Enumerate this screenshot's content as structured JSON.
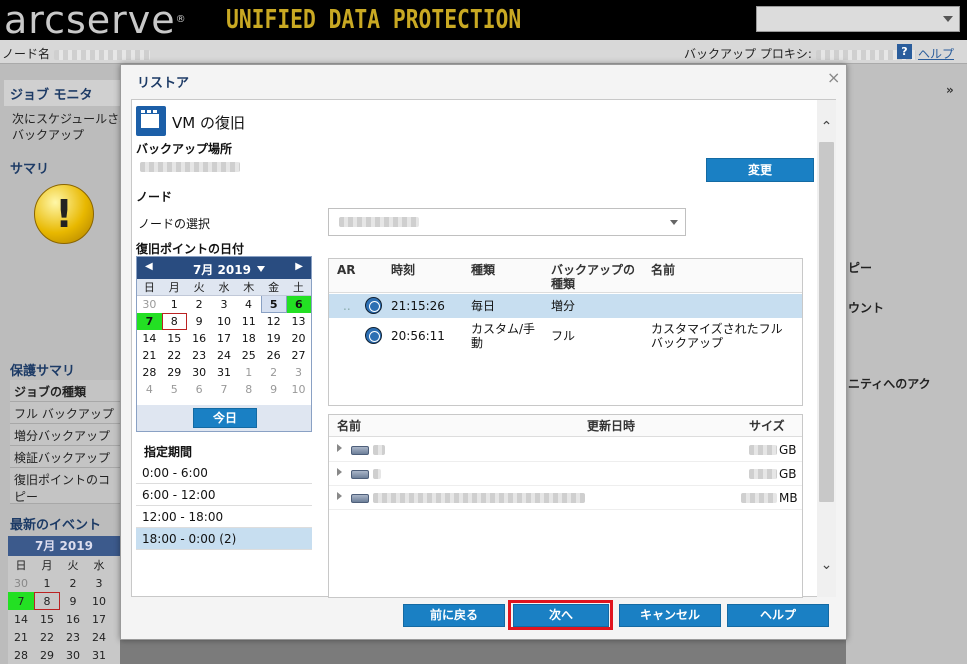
{
  "app": {
    "brand": "arcserve",
    "brand_mark": "®",
    "product": "UNIFIED DATA PROTECTION",
    "node_label": "ノード名",
    "proxy_label": "バックアップ プロキシ:",
    "help_icon_text": "?",
    "help_label": "ヘルプ"
  },
  "left_panel": {
    "job_monitor": "ジョブ モニタ",
    "job_monitor_text1": "次にスケジュールされ",
    "job_monitor_text2": "バックアップ",
    "summary": "サマリ",
    "warning_glyph": "!",
    "protection_summary": "保護サマリ",
    "job_types_header": "ジョブの種類",
    "job_types": [
      "フル バックアップ",
      "増分バックアップ",
      "検証バックアップ",
      "復旧ポイントのコ",
      "ピー"
    ],
    "latest_events": "最新のイベント",
    "mini_cal": {
      "month": "7月 2019",
      "weekdays": [
        "日",
        "月",
        "火",
        "水"
      ],
      "rows": [
        [
          "30",
          "1",
          "2",
          "3"
        ],
        [
          "7",
          "8",
          "9",
          "10"
        ],
        [
          "14",
          "15",
          "16",
          "17"
        ],
        [
          "21",
          "22",
          "23",
          "24"
        ],
        [
          "28",
          "29",
          "30",
          "31"
        ]
      ]
    }
  },
  "right_panel": {
    "collapse": "»",
    "text1": "ピー",
    "text2": "ウント",
    "text3": "ニティへのアク"
  },
  "dialog": {
    "title": "リストア",
    "close": "×",
    "vm_title": "VM の復旧",
    "backup_location_label": "バックアップ場所",
    "change_button": "変更",
    "node_section": "ノード",
    "node_select_label": "ノードの選択",
    "recovery_date_label": "復旧ポイントの日付",
    "calendar": {
      "month": "7月 2019",
      "prev": "◀",
      "next": "▶",
      "weekdays": [
        "日",
        "月",
        "火",
        "水",
        "木",
        "金",
        "土"
      ],
      "weeks": [
        [
          "30",
          "1",
          "2",
          "3",
          "4",
          "5",
          "6"
        ],
        [
          "7",
          "8",
          "9",
          "10",
          "11",
          "12",
          "13"
        ],
        [
          "14",
          "15",
          "16",
          "17",
          "18",
          "19",
          "20"
        ],
        [
          "21",
          "22",
          "23",
          "24",
          "25",
          "26",
          "27"
        ],
        [
          "28",
          "29",
          "30",
          "31",
          "1",
          "2",
          "3"
        ],
        [
          "4",
          "5",
          "6",
          "7",
          "8",
          "9",
          "10"
        ]
      ],
      "today_button": "今日"
    },
    "period_header": "指定期間",
    "periods": [
      "0:00 - 6:00",
      "6:00 - 12:00",
      "12:00 - 18:00",
      "18:00 - 0:00   (2)"
    ],
    "recovery_points": {
      "columns": {
        "ar": "AR",
        "time": "時刻",
        "kind": "種類",
        "backup_kind_1": "バックアップの",
        "backup_kind_2": "種類",
        "name": "名前"
      },
      "rows": [
        {
          "ar": "..",
          "time": "21:15:26",
          "kind": "毎日",
          "backup_kind": "増分",
          "name_1": "",
          "name_2": ""
        },
        {
          "ar": "",
          "time": "20:56:11",
          "kind_1": "カスタム/手",
          "kind_2": "動",
          "backup_kind": "フル",
          "name_1": "カスタマイズされたフル",
          "name_2": "バックアップ"
        }
      ]
    },
    "files": {
      "columns": {
        "name": "名前",
        "modified": "更新日時",
        "size": "サイズ"
      },
      "rows": [
        {
          "size_unit": "GB"
        },
        {
          "size_unit": "GB"
        },
        {
          "size_unit": "MB"
        }
      ]
    },
    "scroll_up": "⌃",
    "scroll_down": "⌄",
    "buttons": {
      "back": "前に戻る",
      "next": "次へ",
      "cancel": "キャンセル",
      "help": "ヘルプ"
    }
  },
  "colors": {
    "accent": "#1a80c4",
    "calendar_header": "#294c80",
    "backup_day": "#23e023",
    "highlight": "#e0141e"
  }
}
